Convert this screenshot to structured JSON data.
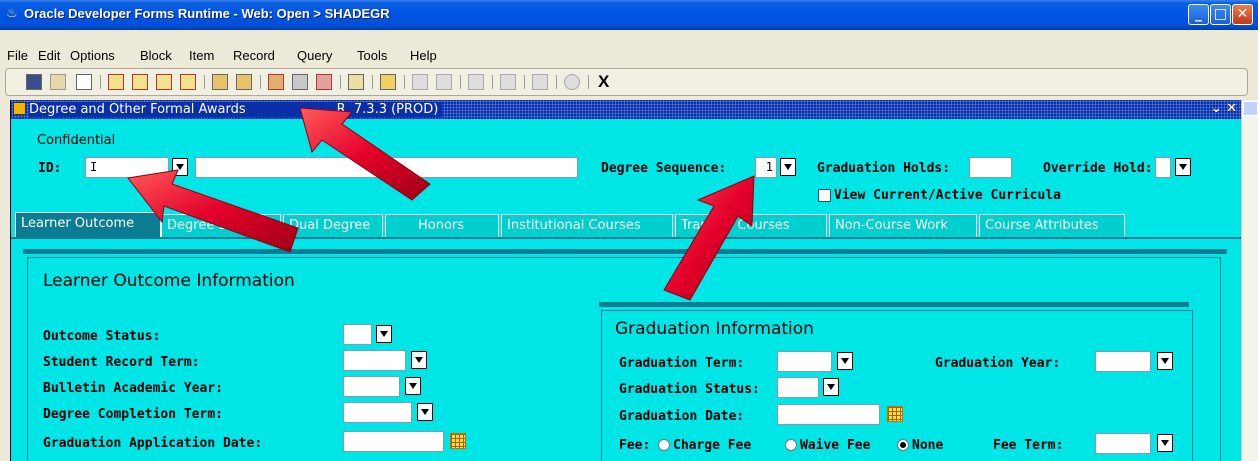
{
  "window": {
    "title": "Oracle Developer Forms Runtime - Web:  Open > SHADEGR"
  },
  "menu": [
    "File",
    "Edit",
    "Options",
    "Block",
    "Item",
    "Record",
    "Query",
    "Tools",
    "Help"
  ],
  "toolbar": {
    "exit_label": "X"
  },
  "form": {
    "title": "Degree and Other Formal Awards",
    "title_suffix": "7.3.3  (PROD)",
    "title_hidden_part": "R",
    "confidential": "Confidential",
    "id_label": "ID:",
    "id_value": "I",
    "degree_seq_label": "Degree Sequence:",
    "degree_seq_value": "1",
    "grad_holds_label": "Graduation Holds:",
    "override_hold_label": "Override Hold:",
    "view_current_label": "View Current/Active Curricula"
  },
  "tabs": [
    {
      "label": "Learner Outcome"
    },
    {
      "label": "Degree Details"
    },
    {
      "label": "Dual Degree"
    },
    {
      "label": "Honors"
    },
    {
      "label": "Institutional Courses"
    },
    {
      "label": "Transfer Courses"
    },
    {
      "label": "Non-Course Work"
    },
    {
      "label": "Course Attributes"
    }
  ],
  "learner": {
    "heading": "Learner Outcome Information",
    "outcome_status": "Outcome Status:",
    "student_record_term": "Student Record Term:",
    "bulletin_year": "Bulletin Academic Year:",
    "completion_term": "Degree Completion Term:",
    "application_date": "Graduation Application Date:"
  },
  "graduation": {
    "heading": "Graduation Information",
    "term": "Graduation Term:",
    "year": "Graduation Year:",
    "status": "Graduation Status:",
    "date": "Graduation Date:",
    "fee": "Fee:",
    "charge_fee": "Charge Fee",
    "waive_fee": "Waive Fee",
    "none": "None",
    "fee_term": "Fee Term:"
  },
  "colors": {
    "form_bg": "#00E5E5",
    "tab_active": "#0A7D95",
    "titlebar": "#0054E3",
    "arrow": "#E4002B"
  }
}
